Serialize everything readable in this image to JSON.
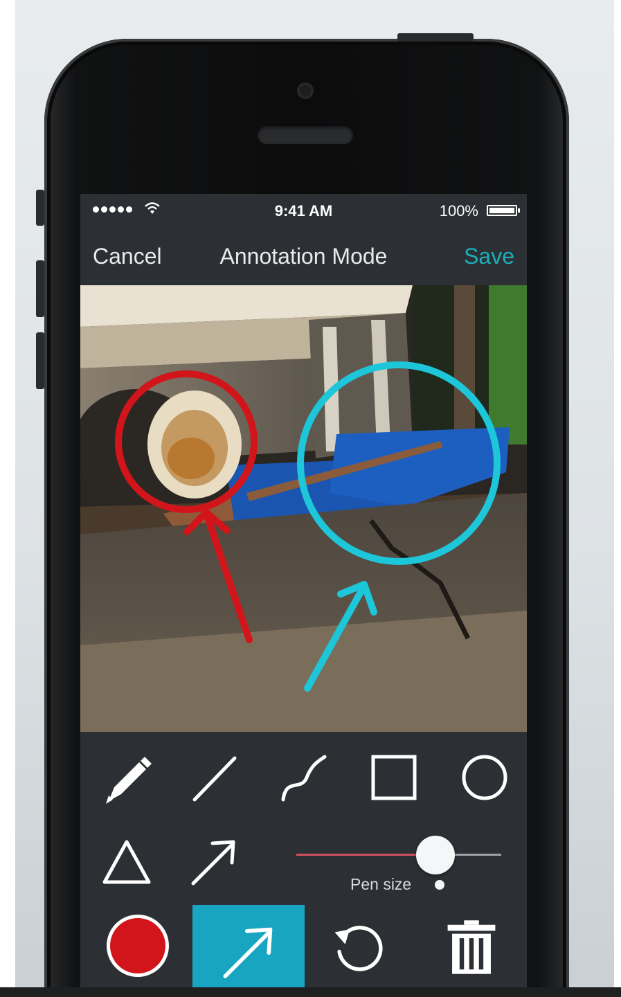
{
  "status_bar": {
    "time": "9:41 AM",
    "battery": "100%"
  },
  "nav": {
    "cancel": "Cancel",
    "title": "Annotation Mode",
    "save": "Save"
  },
  "colors": {
    "accent_save": "#1ab0b8",
    "annotation_red": "#d2151b",
    "annotation_cyan": "#1dc6d9",
    "active_tool_bg": "#18a5c2",
    "selected_color": "#d2151b"
  },
  "tools": {
    "items": [
      "pencil-icon",
      "line-icon",
      "curve-icon",
      "rectangle-icon",
      "circle-icon",
      "triangle-icon",
      "arrow-icon"
    ],
    "pen_size_label": "Pen size",
    "pen_size_fraction": 0.68
  },
  "bottom_bar": {
    "selected_color": "#d2151b",
    "active_tool": "arrow-icon",
    "actions": [
      "undo-icon",
      "trash-icon"
    ]
  }
}
